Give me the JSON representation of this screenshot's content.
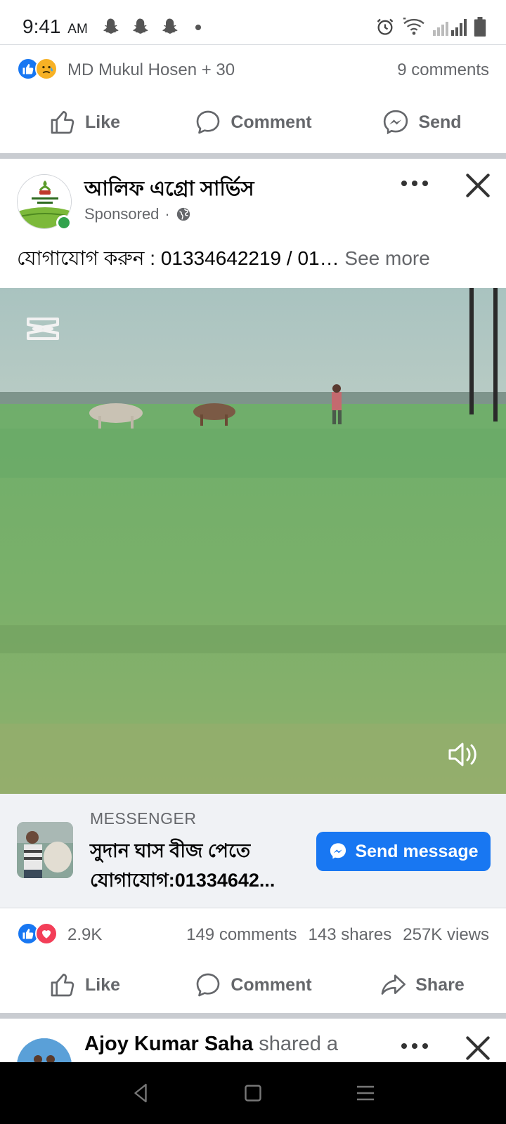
{
  "status_bar": {
    "time": "9:41",
    "ampm": "AM",
    "icons": [
      "snapchat-icon",
      "snapchat-icon",
      "snapchat-icon",
      "dot-icon",
      "alarm-icon",
      "wifi-icon",
      "signal-icon",
      "battery-icon"
    ]
  },
  "previous_post": {
    "reactions_text": "MD Mukul Hosen + 30",
    "comments": "9 comments",
    "actions": {
      "like": "Like",
      "comment": "Comment",
      "send": "Send"
    }
  },
  "ad_post": {
    "page_name": "আলিফ এগ্রো সার্ভিস",
    "sponsored": "Sponsored",
    "caption": "যোগাযোগ করুন : 01334642219 / 01…",
    "see_more": "See more",
    "cta": {
      "label": "MESSENGER",
      "title_line1": "সুদান ঘাস বীজ পেতে",
      "title_line2": "যোগাযোগ:01334642...",
      "button": "Send message"
    },
    "stats": {
      "reactions": "2.9K",
      "comments": "149 comments",
      "shares": "143 shares",
      "views": "257K views"
    },
    "actions": {
      "like": "Like",
      "comment": "Comment",
      "share": "Share"
    }
  },
  "next_post": {
    "author": "Ajoy Kumar Saha",
    "action": "shared a"
  },
  "colors": {
    "accent": "#1877f2",
    "muted": "#65676b",
    "online": "#31a24c",
    "love": "#f33e58"
  }
}
